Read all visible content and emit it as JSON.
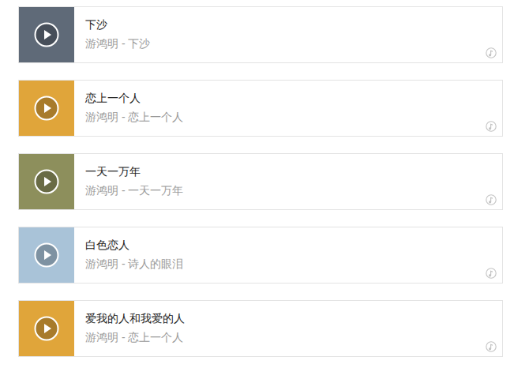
{
  "songs": [
    {
      "title": "下沙",
      "subtitle": "游鸿明 - 下沙",
      "color": "#5f6a78"
    },
    {
      "title": "恋上一个人",
      "subtitle": "游鸿明 - 恋上一个人",
      "color": "#e0a53a"
    },
    {
      "title": "一天一万年",
      "subtitle": "游鸿明 - 一天一万年",
      "color": "#8d8f5c"
    },
    {
      "title": "白色恋人",
      "subtitle": "游鸿明 - 诗人的眼泪",
      "color": "#a9c3d8"
    },
    {
      "title": "爱我的人和我爱的人",
      "subtitle": "游鸿明 - 恋上一个人",
      "color": "#e0a53a"
    }
  ]
}
